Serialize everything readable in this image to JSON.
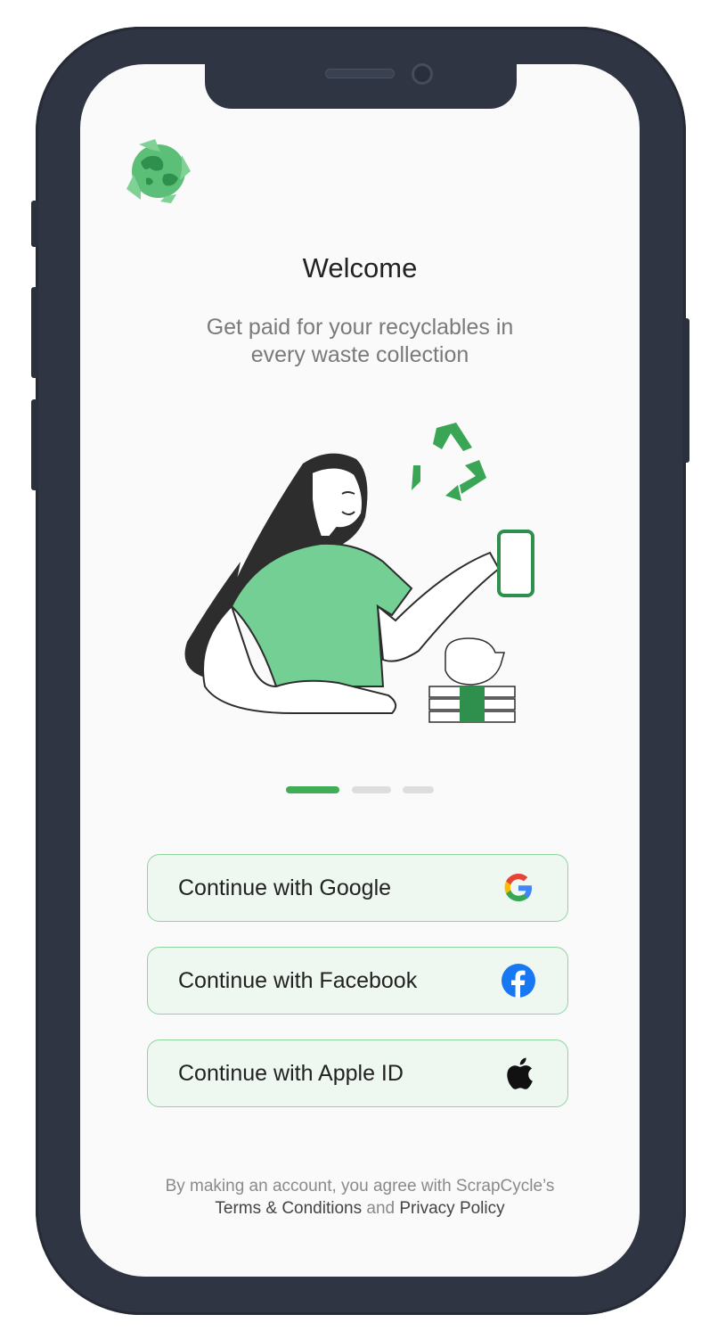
{
  "app": {
    "logo": "recycle-globe-logo",
    "title": "Welcome",
    "subtitle_line1": "Get paid for your recyclables in",
    "subtitle_line2": "every waste collection",
    "illustration": "woman-phone-recycle-illustration"
  },
  "carousel": {
    "total": 3,
    "active_index": 0
  },
  "buttons": [
    {
      "label": "Continue with Google",
      "icon": "google-icon"
    },
    {
      "label": "Continue with Facebook",
      "icon": "facebook-icon"
    },
    {
      "label": "Continue with Apple ID",
      "icon": "apple-icon"
    }
  ],
  "footer": {
    "line1": "By making an account, you agree with ScrapCycle’s",
    "terms": "Terms & Conditions",
    "and": "and",
    "privacy": "Privacy Policy"
  },
  "colors": {
    "accent": "#3fae57",
    "button_bg": "#eef7f0",
    "button_border": "#8fd49f",
    "phone_frame": "#2f3542"
  }
}
